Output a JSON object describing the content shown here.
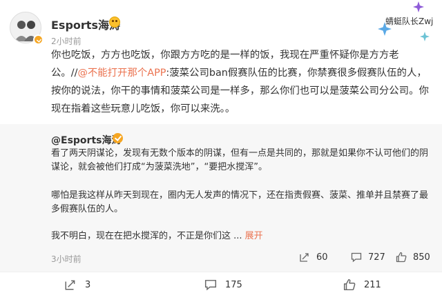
{
  "post": {
    "username": "Esports海涛",
    "time": "2小时前",
    "text_before_mention": "你也吃饭，方方也吃饭，你跟方方吃的是一样的饭，我现在严重怀疑你是方方老公。//",
    "mention": "@不能打开那个APP",
    "text_after_mention": ":菠菜公司ban假赛队伍的比赛，你禁赛很多假赛队伍的人，按你的说法，你干的事情和菠菜公司是一样多，那么你们也可以是菠菜公司分公司。你现在指着这些玩意儿吃饭，你可以来洗。。"
  },
  "watermark": {
    "text": "蜻蜓队长Zwj"
  },
  "retweet": {
    "author": "@Esports海涛",
    "para1": "看了两天阴谋论，发现有无数个版本的阴谋，但有一点是共同的，那就是如果你不认可他们的阴谋论，就会被他们打成“为菠菜洗地”，“要把水搅浑”。",
    "para2": "哪怕是我这样从昨天到现在，圈内无人发声的情况下，还在指责假赛、菠菜、推单并且禁赛了最多假赛队伍的人。",
    "para3": "我不明白，现在在把水搅浑的，不正是你们这 ...",
    "expand_label": "展开",
    "time": "3小时前",
    "share_count": "60",
    "comment_count": "727",
    "like_count": "850"
  },
  "actions": {
    "share_count": "3",
    "comment_count": "175",
    "like_count": "211"
  },
  "colors": {
    "accent": "#eb7350",
    "verified": "#f5a623",
    "muted": "#999999"
  },
  "icons": [
    "avatar-illustration",
    "verified-badge",
    "vip-emoji-icon",
    "sparkle-icon",
    "share-icon",
    "comment-icon",
    "like-icon"
  ]
}
